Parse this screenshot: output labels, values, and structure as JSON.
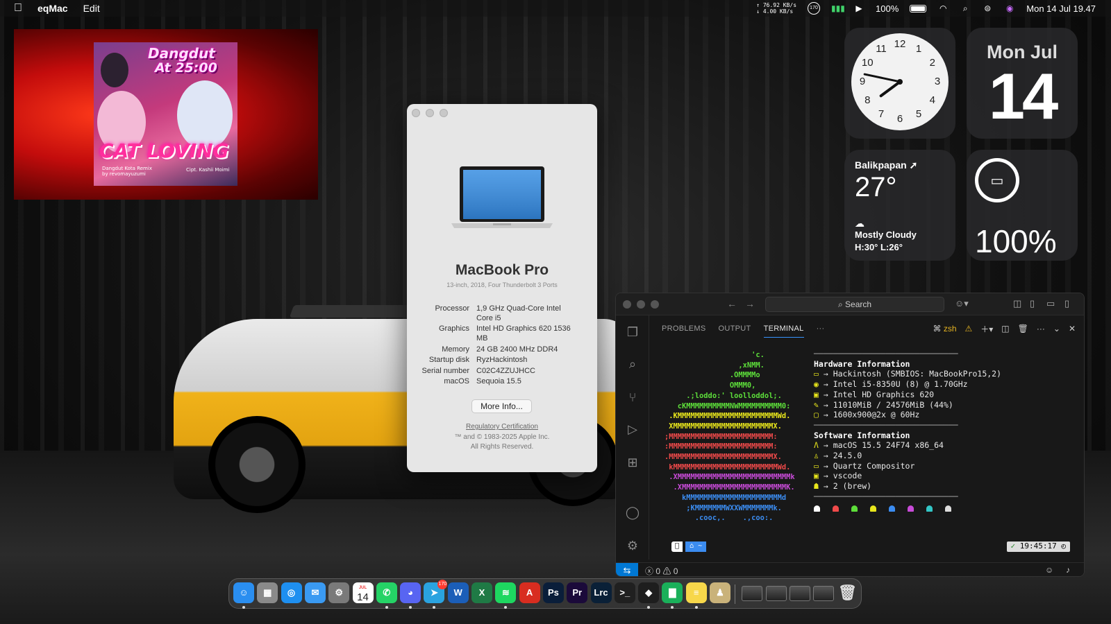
{
  "menubar": {
    "app_name": "eqMac",
    "menu_edit": "Edit",
    "net_up": "↑ 76.92 KB/s",
    "net_down": "↓  4.00 KB/s",
    "cpu_badge": "170",
    "battery": "100%",
    "datetime": "Mon 14 Jul  19.47"
  },
  "album": {
    "title_line1": "Dangdut",
    "title_line2": "At 25:00",
    "art_main": "CAT LOVING",
    "art_left": "Dangdut Kota Remix\nby revomayuzumi",
    "art_right": "Cipt. Kashii Moimi"
  },
  "widgets": {
    "clock_numbers": [
      "12",
      "1",
      "2",
      "3",
      "4",
      "5",
      "6",
      "7",
      "8",
      "9",
      "10",
      "11"
    ],
    "clock_time": {
      "hour": 7,
      "minute": 47
    },
    "calendar_day": "Mon Jul",
    "calendar_date": "14",
    "weather_city": "Balikpapan",
    "weather_temp": "27°",
    "weather_condition": "Mostly Cloudy",
    "weather_hilo": "H:30° L:26°",
    "battery_pct": "100%"
  },
  "about": {
    "model": "MacBook Pro",
    "subtitle": "13-inch, 2018, Four Thunderbolt 3 Ports",
    "specs": [
      {
        "k": "Processor",
        "v": "1,9 GHz Quad-Core Intel Core i5"
      },
      {
        "k": "Graphics",
        "v": "Intel HD Graphics 620 1536 MB"
      },
      {
        "k": "Memory",
        "v": "24 GB 2400 MHz DDR4"
      },
      {
        "k": "Startup disk",
        "v": "RyzHackintosh"
      },
      {
        "k": "Serial number",
        "v": "C02C4ZZUJHCC"
      },
      {
        "k": "macOS",
        "v": "Sequoia 15.5"
      }
    ],
    "more_info": "More Info...",
    "regulatory": "Regulatory Certification",
    "copyright": "™ and © 1983-2025 Apple Inc.",
    "rights": "All Rights Reserved."
  },
  "vscode": {
    "search": "Search",
    "tabs": [
      "PROBLEMS",
      "OUTPUT",
      "TERMINAL",
      "···"
    ],
    "shell": "zsh",
    "ascii": [
      {
        "t": "                    'c.",
        "c": "#5dde3a"
      },
      {
        "t": "                 ,xNMM.",
        "c": "#5dde3a"
      },
      {
        "t": "               .OMMMMo",
        "c": "#5dde3a"
      },
      {
        "t": "               OMMM0,",
        "c": "#5dde3a"
      },
      {
        "t": "     .;loddo:' loolloddol;.",
        "c": "#5dde3a"
      },
      {
        "t": "   cKMMMMMMMMMMNWMMMMMMMMMM0:",
        "c": "#5dde3a"
      },
      {
        "t": " .KMMMMMMMMMMMMMMMMMMMMMMMWd.",
        "c": "#e8e61c"
      },
      {
        "t": " XMMMMMMMMMMMMMMMMMMMMMMMX.",
        "c": "#e8e61c"
      },
      {
        "t": ";MMMMMMMMMMMMMMMMMMMMMMMM:",
        "c": "#f04a4a"
      },
      {
        "t": ":MMMMMMMMMMMMMMMMMMMMMMMM:",
        "c": "#f04a4a"
      },
      {
        "t": ".MMMMMMMMMMMMMMMMMMMMMMMMX.",
        "c": "#f04a4a"
      },
      {
        "t": " kMMMMMMMMMMMMMMMMMMMMMMMMWd.",
        "c": "#f04a4a"
      },
      {
        "t": " .XMMMMMMMMMMMMMMMMMMMMMMMMMMk",
        "c": "#c84bd8"
      },
      {
        "t": "  .XMMMMMMMMMMMMMMMMMMMMMMMMK.",
        "c": "#c84bd8"
      },
      {
        "t": "    kMMMMMMMMMMMMMMMMMMMMMMd",
        "c": "#3b8cf0"
      },
      {
        "t": "     ;KMMMMMMMWXXWMMMMMMMk.",
        "c": "#3b8cf0"
      },
      {
        "t": "       .cooc,.    .,coo:.",
        "c": "#3b8cf0"
      }
    ],
    "info_sep": "──────────────────────────────",
    "hw_title": "Hardware Information",
    "hw": [
      {
        "icon": "▭",
        "text": "Hackintosh (SMBIOS: MacBookPro15,2)",
        "c": "#e8e61c"
      },
      {
        "icon": "◉",
        "text": "Intel i5-8350U (8) @ 1.70GHz",
        "c": "#e8e61c"
      },
      {
        "icon": "▣",
        "text": "Intel HD Graphics 620",
        "c": "#e8e61c"
      },
      {
        "icon": "✎",
        "text": "11010MiB / 24576MiB (44%)",
        "c": "#e8e61c"
      },
      {
        "icon": "▢",
        "text": "1600x900@2x @ 60Hz",
        "c": "#e8e61c"
      }
    ],
    "sw_title": "Software Information",
    "sw": [
      {
        "icon": "Ʌ",
        "text": "macOS 15.5 24F74 x86_64",
        "c": "#e8e61c"
      },
      {
        "icon": "♙",
        "text": "24.5.0",
        "c": "#e8e61c"
      },
      {
        "icon": "▭",
        "text": "Quartz Compositor",
        "c": "#e8e61c"
      },
      {
        "icon": "▣",
        "text": "vscode",
        "c": "#e8e61c"
      },
      {
        "icon": "☗",
        "text": "2 (brew)",
        "c": "#e8e61c"
      }
    ],
    "palette": [
      "#ffffff",
      "#f04a4a",
      "#5dde3a",
      "#e8e61c",
      "#3b8cf0",
      "#c84bd8",
      "#33c6c6",
      "#dddddd"
    ],
    "prompt_dir": "~",
    "prompt_time": "19:45:17",
    "errors": "0",
    "warnings": "0"
  },
  "dock": {
    "calendar_day": "14",
    "calendar_month": "JUL",
    "telegram_badge": "170",
    "items": [
      {
        "name": "finder",
        "label": "☺",
        "bg": "#2a8ef0"
      },
      {
        "name": "launchpad",
        "label": "▦",
        "bg": "#8a8a8a"
      },
      {
        "name": "safari",
        "label": "◎",
        "bg": "#1e8ff0"
      },
      {
        "name": "mail",
        "label": "✉",
        "bg": "#3a9af2"
      },
      {
        "name": "settings",
        "label": "⚙",
        "bg": "#7a7a7a"
      },
      {
        "name": "calendar",
        "label": "",
        "bg": "#ffffff"
      },
      {
        "name": "whatsapp",
        "label": "✆",
        "bg": "#25d366"
      },
      {
        "name": "discord",
        "label": "◕",
        "bg": "#5865f2"
      },
      {
        "name": "telegram",
        "label": "➤",
        "bg": "#2aa3e0"
      },
      {
        "name": "word",
        "label": "W",
        "bg": "#1b5eb8"
      },
      {
        "name": "excel",
        "label": "X",
        "bg": "#1f7a45"
      },
      {
        "name": "spotify",
        "label": "≋",
        "bg": "#1ed760"
      },
      {
        "name": "acrobat",
        "label": "A",
        "bg": "#d82d20"
      },
      {
        "name": "photoshop",
        "label": "Ps",
        "bg": "#0a1e3a"
      },
      {
        "name": "premiere",
        "label": "Pr",
        "bg": "#1b0a3a"
      },
      {
        "name": "lightroom",
        "label": "Lrc",
        "bg": "#0a2037"
      },
      {
        "name": "terminal",
        "label": ">_",
        "bg": "#202020"
      },
      {
        "name": "vscode",
        "label": "◆",
        "bg": "#1e1e1e"
      },
      {
        "name": "eqmac",
        "label": "▇",
        "bg": "#1ab05a"
      },
      {
        "name": "notes",
        "label": "≡",
        "bg": "#f7d74a"
      },
      {
        "name": "automator",
        "label": "♟",
        "bg": "#c9b27a"
      }
    ]
  }
}
